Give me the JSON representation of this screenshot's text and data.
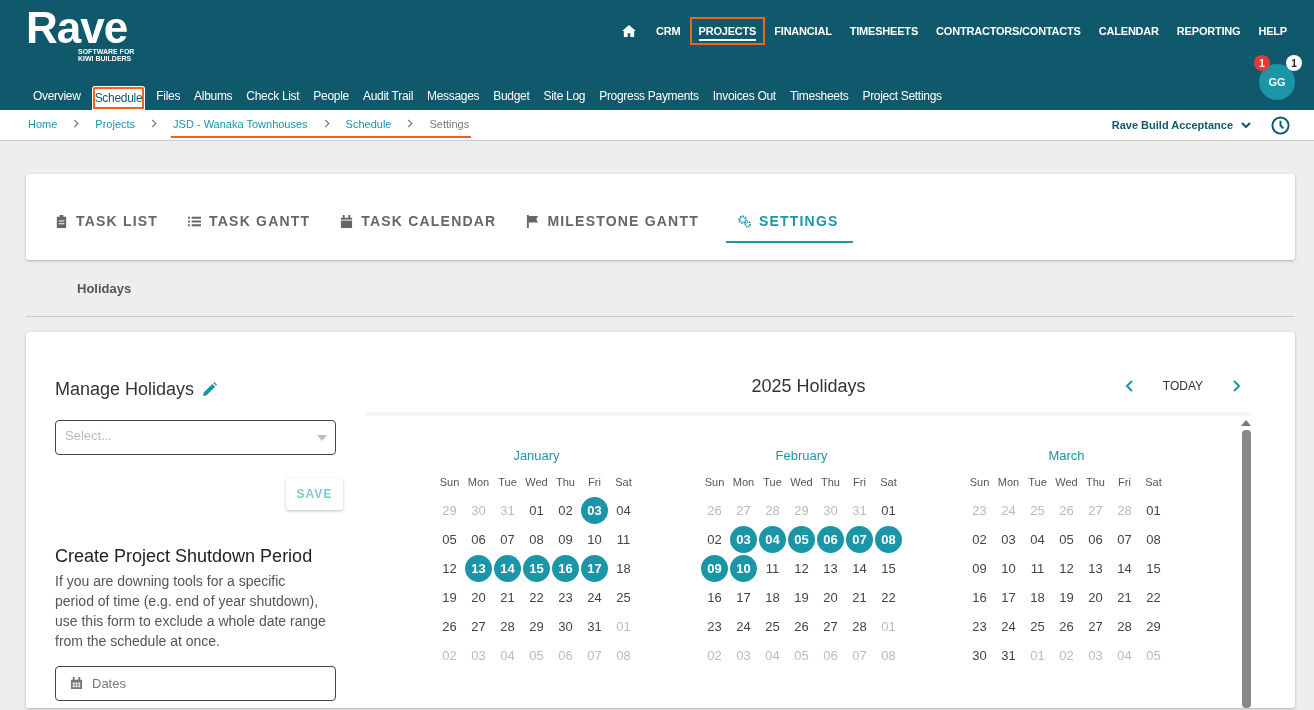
{
  "logo": {
    "name": "Rave",
    "tagline_1": "SOFTWARE FOR",
    "tagline_2": "KIWI BUILDERS"
  },
  "main_nav": [
    {
      "label": "CRM",
      "selected": false,
      "highlighted": false
    },
    {
      "label": "PROJECTS",
      "selected": true,
      "highlighted": true
    },
    {
      "label": "FINANCIAL",
      "selected": false,
      "highlighted": false
    },
    {
      "label": "TIMESHEETS",
      "selected": false,
      "highlighted": false
    },
    {
      "label": "CONTRACTORS/CONTACTS",
      "selected": false,
      "highlighted": false
    },
    {
      "label": "CALENDAR",
      "selected": false,
      "highlighted": false
    },
    {
      "label": "REPORTING",
      "selected": false,
      "highlighted": false
    },
    {
      "label": "HELP",
      "selected": false,
      "highlighted": false
    }
  ],
  "project_nav": [
    {
      "label": "Overview",
      "selected": false,
      "highlighted": false
    },
    {
      "label": "Schedule",
      "selected": true,
      "highlighted": true
    },
    {
      "label": "Files",
      "selected": false,
      "highlighted": false
    },
    {
      "label": "Albums",
      "selected": false,
      "highlighted": false
    },
    {
      "label": "Check List",
      "selected": false,
      "highlighted": false
    },
    {
      "label": "People",
      "selected": false,
      "highlighted": false
    },
    {
      "label": "Audit Trail",
      "selected": false,
      "highlighted": false
    },
    {
      "label": "Messages",
      "selected": false,
      "highlighted": false
    },
    {
      "label": "Budget",
      "selected": false,
      "highlighted": false
    },
    {
      "label": "Site Log",
      "selected": false,
      "highlighted": false
    },
    {
      "label": "Progress Payments",
      "selected": false,
      "highlighted": false
    },
    {
      "label": "Invoices Out",
      "selected": false,
      "highlighted": false
    },
    {
      "label": "Timesheets",
      "selected": false,
      "highlighted": false
    },
    {
      "label": "Project Settings",
      "selected": false,
      "highlighted": false
    }
  ],
  "user": {
    "initials": "GG",
    "badge_alert": "1",
    "badge_count": "1"
  },
  "breadcrumbs": [
    {
      "label": "Home",
      "current": false,
      "highlighted": false
    },
    {
      "label": "Projects",
      "current": false,
      "highlighted": false
    },
    {
      "label": "JSD - Wanaka Townhouses",
      "current": false,
      "highlighted": true
    },
    {
      "label": "Schedule",
      "current": false,
      "highlighted": true
    },
    {
      "label": "Settings",
      "current": true,
      "highlighted": true
    }
  ],
  "company_selector": {
    "label": "Rave Build Acceptance"
  },
  "tabs": [
    {
      "label": "TASK LIST",
      "selected": false
    },
    {
      "label": "TASK GANTT",
      "selected": false
    },
    {
      "label": "TASK CALENDAR",
      "selected": false
    },
    {
      "label": "MILESTONE GANTT",
      "selected": false
    },
    {
      "label": "SETTINGS",
      "selected": true
    }
  ],
  "section_tabs": [
    {
      "label": "Holidays"
    }
  ],
  "manage_holidays": {
    "title": "Manage Holidays",
    "select_placeholder": "Select...",
    "save_button": "SAVE"
  },
  "shutdown": {
    "title": "Create Project Shutdown Period",
    "description": "If you are downing tools for a specific period of time (e.g. end of year shutdown), use this form to exclude a whole date range from the schedule at once.",
    "dates_placeholder": "Dates"
  },
  "calendar": {
    "title": "2025 Holidays",
    "today_button": "TODAY",
    "months": [
      {
        "name": "January",
        "weekdays": [
          "Sun",
          "Mon",
          "Tue",
          "Wed",
          "Thu",
          "Fri",
          "Sat"
        ],
        "weeks": [
          [
            {
              "d": "29",
              "outside": true,
              "holiday": false
            },
            {
              "d": "30",
              "outside": true,
              "holiday": false
            },
            {
              "d": "31",
              "outside": true,
              "holiday": false
            },
            {
              "d": "01",
              "outside": false,
              "holiday": false
            },
            {
              "d": "02",
              "outside": false,
              "holiday": false
            },
            {
              "d": "03",
              "outside": false,
              "holiday": true
            },
            {
              "d": "04",
              "outside": false,
              "holiday": false
            }
          ],
          [
            {
              "d": "05",
              "outside": false,
              "holiday": false
            },
            {
              "d": "06",
              "outside": false,
              "holiday": false
            },
            {
              "d": "07",
              "outside": false,
              "holiday": false
            },
            {
              "d": "08",
              "outside": false,
              "holiday": false
            },
            {
              "d": "09",
              "outside": false,
              "holiday": false
            },
            {
              "d": "10",
              "outside": false,
              "holiday": false
            },
            {
              "d": "11",
              "outside": false,
              "holiday": false
            }
          ],
          [
            {
              "d": "12",
              "outside": false,
              "holiday": false
            },
            {
              "d": "13",
              "outside": false,
              "holiday": true
            },
            {
              "d": "14",
              "outside": false,
              "holiday": true
            },
            {
              "d": "15",
              "outside": false,
              "holiday": true
            },
            {
              "d": "16",
              "outside": false,
              "holiday": true
            },
            {
              "d": "17",
              "outside": false,
              "holiday": true
            },
            {
              "d": "18",
              "outside": false,
              "holiday": false
            }
          ],
          [
            {
              "d": "19",
              "outside": false,
              "holiday": false
            },
            {
              "d": "20",
              "outside": false,
              "holiday": false
            },
            {
              "d": "21",
              "outside": false,
              "holiday": false
            },
            {
              "d": "22",
              "outside": false,
              "holiday": false
            },
            {
              "d": "23",
              "outside": false,
              "holiday": false
            },
            {
              "d": "24",
              "outside": false,
              "holiday": false
            },
            {
              "d": "25",
              "outside": false,
              "holiday": false
            }
          ],
          [
            {
              "d": "26",
              "outside": false,
              "holiday": false
            },
            {
              "d": "27",
              "outside": false,
              "holiday": false
            },
            {
              "d": "28",
              "outside": false,
              "holiday": false
            },
            {
              "d": "29",
              "outside": false,
              "holiday": false
            },
            {
              "d": "30",
              "outside": false,
              "holiday": false
            },
            {
              "d": "31",
              "outside": false,
              "holiday": false
            },
            {
              "d": "01",
              "outside": true,
              "holiday": false
            }
          ],
          [
            {
              "d": "02",
              "outside": true,
              "holiday": false
            },
            {
              "d": "03",
              "outside": true,
              "holiday": false
            },
            {
              "d": "04",
              "outside": true,
              "holiday": false
            },
            {
              "d": "05",
              "outside": true,
              "holiday": false
            },
            {
              "d": "06",
              "outside": true,
              "holiday": false
            },
            {
              "d": "07",
              "outside": true,
              "holiday": false
            },
            {
              "d": "08",
              "outside": true,
              "holiday": false
            }
          ]
        ]
      },
      {
        "name": "February",
        "weekdays": [
          "Sun",
          "Mon",
          "Tue",
          "Wed",
          "Thu",
          "Fri",
          "Sat"
        ],
        "weeks": [
          [
            {
              "d": "26",
              "outside": true,
              "holiday": false
            },
            {
              "d": "27",
              "outside": true,
              "holiday": false
            },
            {
              "d": "28",
              "outside": true,
              "holiday": false
            },
            {
              "d": "29",
              "outside": true,
              "holiday": false
            },
            {
              "d": "30",
              "outside": true,
              "holiday": false
            },
            {
              "d": "31",
              "outside": true,
              "holiday": false
            },
            {
              "d": "01",
              "outside": false,
              "holiday": false
            }
          ],
          [
            {
              "d": "02",
              "outside": false,
              "holiday": false
            },
            {
              "d": "03",
              "outside": false,
              "holiday": true
            },
            {
              "d": "04",
              "outside": false,
              "holiday": true
            },
            {
              "d": "05",
              "outside": false,
              "holiday": true
            },
            {
              "d": "06",
              "outside": false,
              "holiday": true
            },
            {
              "d": "07",
              "outside": false,
              "holiday": true
            },
            {
              "d": "08",
              "outside": false,
              "holiday": true
            }
          ],
          [
            {
              "d": "09",
              "outside": false,
              "holiday": true
            },
            {
              "d": "10",
              "outside": false,
              "holiday": true
            },
            {
              "d": "11",
              "outside": false,
              "holiday": false
            },
            {
              "d": "12",
              "outside": false,
              "holiday": false
            },
            {
              "d": "13",
              "outside": false,
              "holiday": false
            },
            {
              "d": "14",
              "outside": false,
              "holiday": false
            },
            {
              "d": "15",
              "outside": false,
              "holiday": false
            }
          ],
          [
            {
              "d": "16",
              "outside": false,
              "holiday": false
            },
            {
              "d": "17",
              "outside": false,
              "holiday": false
            },
            {
              "d": "18",
              "outside": false,
              "holiday": false
            },
            {
              "d": "19",
              "outside": false,
              "holiday": false
            },
            {
              "d": "20",
              "outside": false,
              "holiday": false
            },
            {
              "d": "21",
              "outside": false,
              "holiday": false
            },
            {
              "d": "22",
              "outside": false,
              "holiday": false
            }
          ],
          [
            {
              "d": "23",
              "outside": false,
              "holiday": false
            },
            {
              "d": "24",
              "outside": false,
              "holiday": false
            },
            {
              "d": "25",
              "outside": false,
              "holiday": false
            },
            {
              "d": "26",
              "outside": false,
              "holiday": false
            },
            {
              "d": "27",
              "outside": false,
              "holiday": false
            },
            {
              "d": "28",
              "outside": false,
              "holiday": false
            },
            {
              "d": "01",
              "outside": true,
              "holiday": false
            }
          ],
          [
            {
              "d": "02",
              "outside": true,
              "holiday": false
            },
            {
              "d": "03",
              "outside": true,
              "holiday": false
            },
            {
              "d": "04",
              "outside": true,
              "holiday": false
            },
            {
              "d": "05",
              "outside": true,
              "holiday": false
            },
            {
              "d": "06",
              "outside": true,
              "holiday": false
            },
            {
              "d": "07",
              "outside": true,
              "holiday": false
            },
            {
              "d": "08",
              "outside": true,
              "holiday": false
            }
          ]
        ]
      },
      {
        "name": "March",
        "weekdays": [
          "Sun",
          "Mon",
          "Tue",
          "Wed",
          "Thu",
          "Fri",
          "Sat"
        ],
        "weeks": [
          [
            {
              "d": "23",
              "outside": true,
              "holiday": false
            },
            {
              "d": "24",
              "outside": true,
              "holiday": false
            },
            {
              "d": "25",
              "outside": true,
              "holiday": false
            },
            {
              "d": "26",
              "outside": true,
              "holiday": false
            },
            {
              "d": "27",
              "outside": true,
              "holiday": false
            },
            {
              "d": "28",
              "outside": true,
              "holiday": false
            },
            {
              "d": "01",
              "outside": false,
              "holiday": false
            }
          ],
          [
            {
              "d": "02",
              "outside": false,
              "holiday": false
            },
            {
              "d": "03",
              "outside": false,
              "holiday": false
            },
            {
              "d": "04",
              "outside": false,
              "holiday": false
            },
            {
              "d": "05",
              "outside": false,
              "holiday": false
            },
            {
              "d": "06",
              "outside": false,
              "holiday": false
            },
            {
              "d": "07",
              "outside": false,
              "holiday": false
            },
            {
              "d": "08",
              "outside": false,
              "holiday": false
            }
          ],
          [
            {
              "d": "09",
              "outside": false,
              "holiday": false
            },
            {
              "d": "10",
              "outside": false,
              "holiday": false
            },
            {
              "d": "11",
              "outside": false,
              "holiday": false
            },
            {
              "d": "12",
              "outside": false,
              "holiday": false
            },
            {
              "d": "13",
              "outside": false,
              "holiday": false
            },
            {
              "d": "14",
              "outside": false,
              "holiday": false
            },
            {
              "d": "15",
              "outside": false,
              "holiday": false
            }
          ],
          [
            {
              "d": "16",
              "outside": false,
              "holiday": false
            },
            {
              "d": "17",
              "outside": false,
              "holiday": false
            },
            {
              "d": "18",
              "outside": false,
              "holiday": false
            },
            {
              "d": "19",
              "outside": false,
              "holiday": false
            },
            {
              "d": "20",
              "outside": false,
              "holiday": false
            },
            {
              "d": "21",
              "outside": false,
              "holiday": false
            },
            {
              "d": "22",
              "outside": false,
              "holiday": false
            }
          ],
          [
            {
              "d": "23",
              "outside": false,
              "holiday": false
            },
            {
              "d": "24",
              "outside": false,
              "holiday": false
            },
            {
              "d": "25",
              "outside": false,
              "holiday": false
            },
            {
              "d": "26",
              "outside": false,
              "holiday": false
            },
            {
              "d": "27",
              "outside": false,
              "holiday": false
            },
            {
              "d": "28",
              "outside": false,
              "holiday": false
            },
            {
              "d": "29",
              "outside": false,
              "holiday": false
            }
          ],
          [
            {
              "d": "30",
              "outside": false,
              "holiday": false
            },
            {
              "d": "31",
              "outside": false,
              "holiday": false
            },
            {
              "d": "01",
              "outside": true,
              "holiday": false
            },
            {
              "d": "02",
              "outside": true,
              "holiday": false
            },
            {
              "d": "03",
              "outside": true,
              "holiday": false
            },
            {
              "d": "04",
              "outside": true,
              "holiday": false
            },
            {
              "d": "05",
              "outside": true,
              "holiday": false
            }
          ]
        ]
      }
    ]
  }
}
